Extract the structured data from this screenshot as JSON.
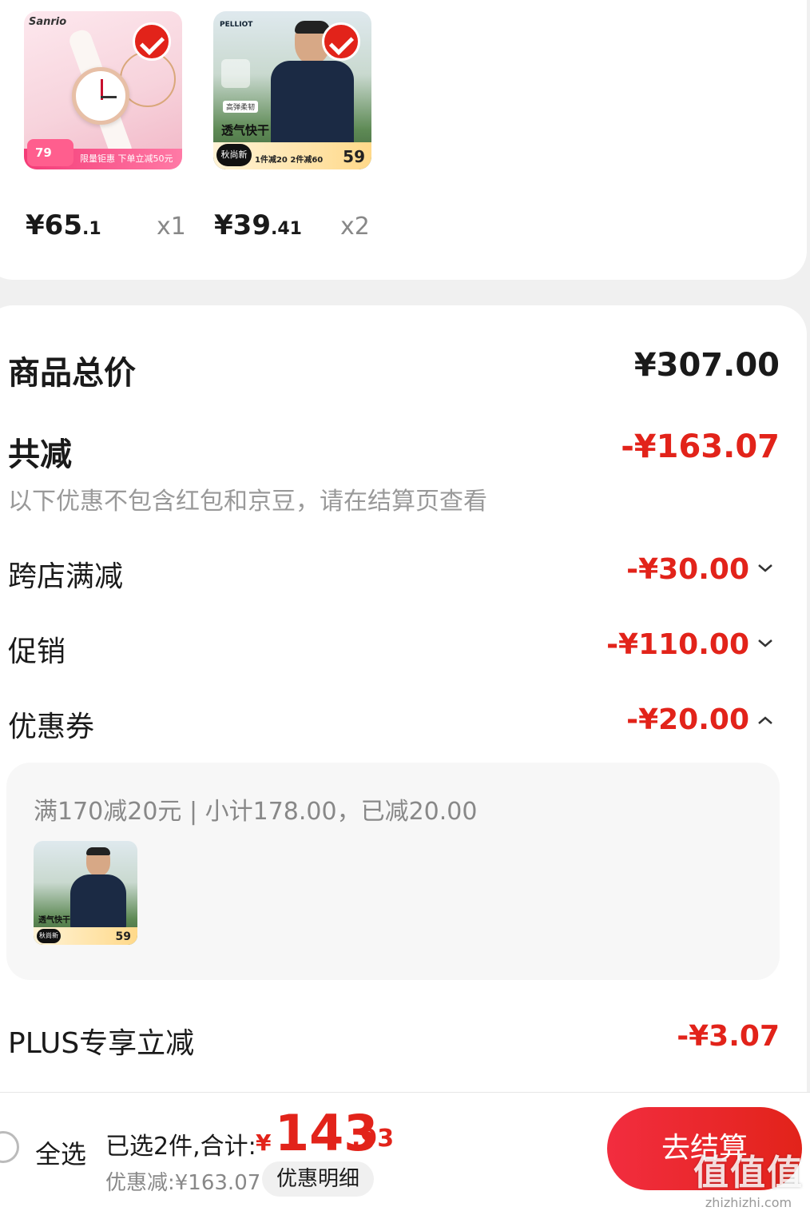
{
  "products": [
    {
      "brand": "Sanrio",
      "promo_text": "限量钜惠 下单立减50元",
      "badge_price": "79",
      "price_int": "¥65",
      "price_dec": ".1",
      "qty": "x1"
    },
    {
      "brand": "PELLIOT",
      "tag1": "高弹柔韧",
      "tag2": "透气快干",
      "new_label": "秋尚新",
      "deal": "1件减20 2件减60",
      "badge_price": "59",
      "price_int": "¥39",
      "price_dec": ".41",
      "qty": "x2"
    }
  ],
  "summary": {
    "total_label": "商品总价",
    "total_value": "¥307.00",
    "discount_label": "共减",
    "discount_value": "-¥163.07",
    "discount_note": "以下优惠不包含红包和京豆，请在结算页查看",
    "rows": [
      {
        "label": "跨店满减",
        "value": "-¥30.00",
        "expanded": false
      },
      {
        "label": "促销",
        "value": "-¥110.00",
        "expanded": false
      },
      {
        "label": "优惠券",
        "value": "-¥20.00",
        "expanded": true
      }
    ],
    "coupon_detail": "满170减20元 | 小计178.00，已减20.00",
    "coupon_thumb": {
      "tag2": "透气快干",
      "new_label": "秋尚新",
      "badge_price": "59"
    },
    "plus_label": "PLUS专享立减",
    "plus_value": "-¥3.07"
  },
  "bottom_bar": {
    "select_all": "全选",
    "selected": "已选2件,合计:",
    "currency": "¥",
    "total_int": "143",
    "total_dec": ".93",
    "saved": "优惠减:¥163.07",
    "detail_button": "优惠明细",
    "checkout_button": "去结算"
  },
  "watermark": {
    "big": "值值值",
    "small": "zhizhizhi.com"
  },
  "colors": {
    "accent_red": "#e2231a",
    "muted": "#888888"
  }
}
